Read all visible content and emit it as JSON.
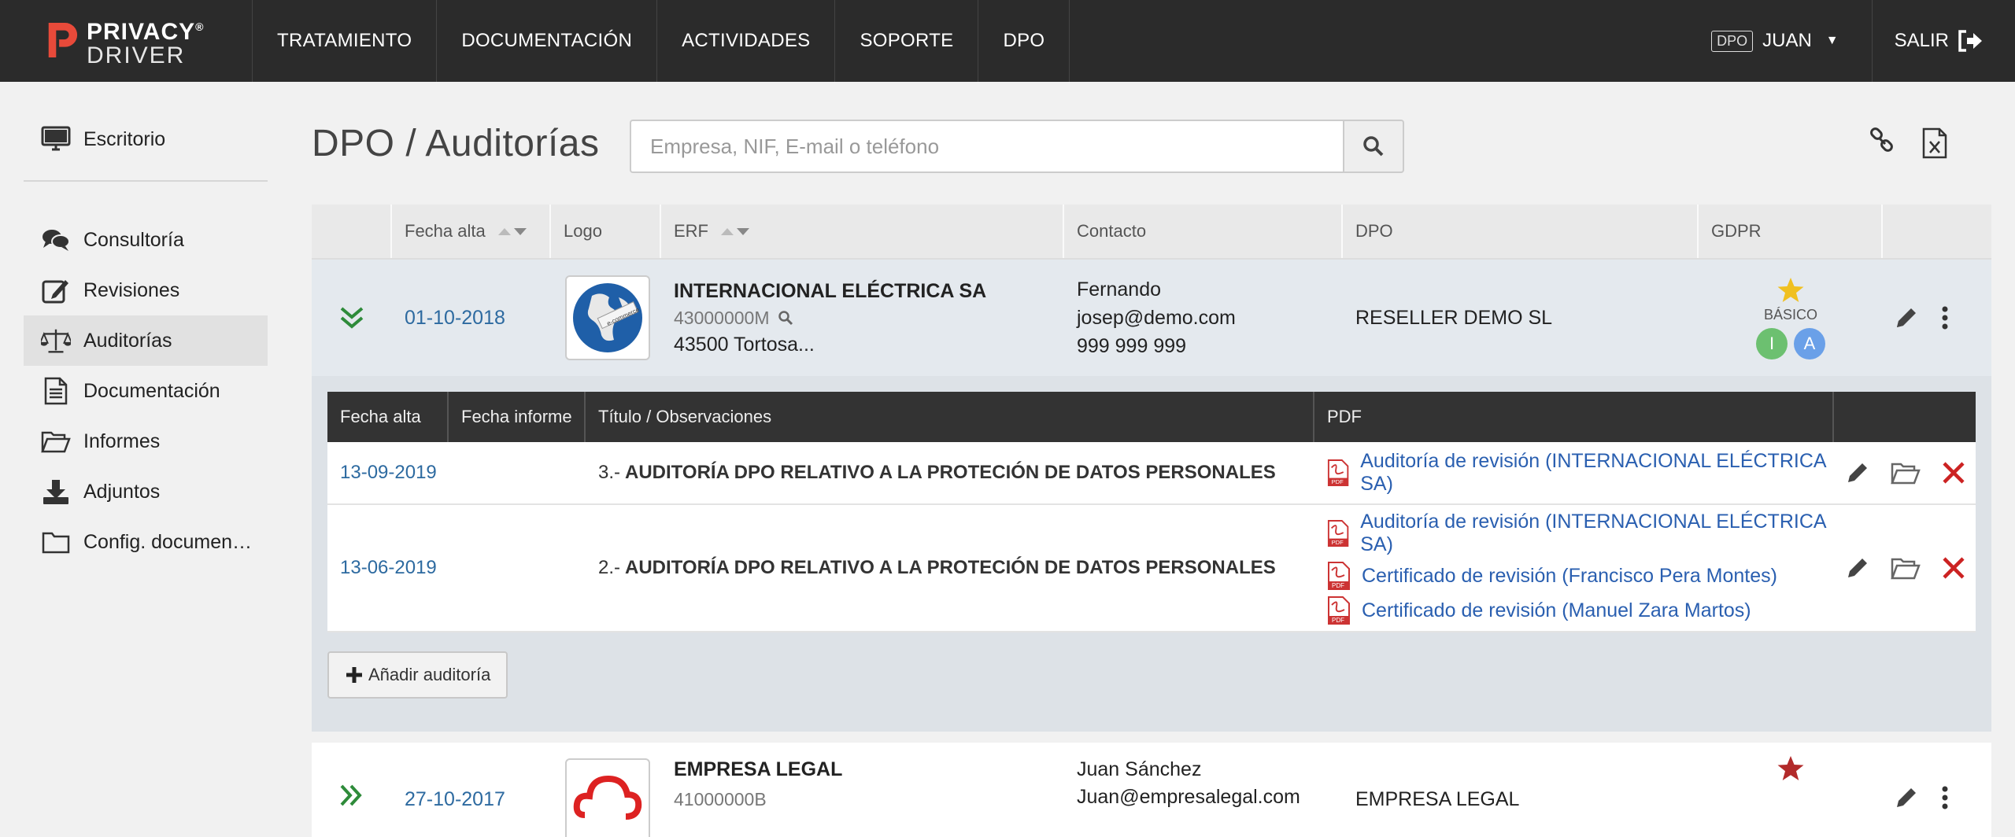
{
  "brand": {
    "line1": "PRIVACY",
    "line2": "DRIVER",
    "reg": "®"
  },
  "nav": [
    "TRATAMIENTO",
    "DOCUMENTACIÓN",
    "ACTIVIDADES",
    "SOPORTE",
    "DPO"
  ],
  "user": {
    "role_badge": "DPO",
    "name": "JUAN"
  },
  "logout_label": "SALIR",
  "sidebar": {
    "top_item": "Escritorio",
    "items": [
      "Consultoría",
      "Revisiones",
      "Auditorías",
      "Documentación",
      "Informes",
      "Adjuntos",
      "Config. documen…"
    ],
    "active": "Auditorías"
  },
  "page_title": "DPO / Auditorías",
  "search": {
    "placeholder": "Empresa, NIF, E-mail o teléfono",
    "value": ""
  },
  "table": {
    "headers": [
      "",
      "Fecha alta",
      "Logo",
      "ERF",
      "Contacto",
      "DPO",
      "GDPR",
      ""
    ],
    "rows": [
      {
        "fecha_alta": "01-10-2018",
        "erf_name": "INTERNACIONAL ELÉCTRICA SA",
        "nif": "43000000M",
        "address": "43500 Tortosa...",
        "contact_name": "Fernando",
        "contact_email": "josep@demo.com",
        "contact_phone": "999 999 999",
        "dpo": "RESELLER DEMO SL",
        "gdpr_level": "BÁSICO",
        "gdpr_badges": [
          "I",
          "A"
        ],
        "star_color": "#f0c020"
      },
      {
        "fecha_alta": "27-10-2017",
        "erf_name": "EMPRESA LEGAL",
        "nif": "41000000B",
        "contact_name": "Juan Sánchez",
        "contact_email": "Juan@empresalegal.com",
        "dpo": "EMPRESA LEGAL",
        "star_color": "#b22a2a"
      }
    ]
  },
  "audits": {
    "headers": [
      "Fecha alta",
      "Fecha informe",
      "Título / Observaciones",
      "PDF",
      ""
    ],
    "rows": [
      {
        "fecha_alta": "13-09-2019",
        "fecha_informe": "",
        "num": "3.-",
        "title": "AUDITORÍA DPO RELATIVO A LA PROTECIÓN DE DATOS PERSONALES",
        "pdfs": [
          "Auditoría de revisión (INTERNACIONAL ELÉCTRICA SA)"
        ]
      },
      {
        "fecha_alta": "13-06-2019",
        "fecha_informe": "",
        "num": "2.-",
        "title": "AUDITORÍA DPO RELATIVO A LA PROTECIÓN DE DATOS PERSONALES",
        "pdfs": [
          "Auditoría de revisión (INTERNACIONAL ELÉCTRICA SA)",
          "Certificado de revisión (Francisco Pera Montes)",
          "Certificado de revisión (Manuel Zara Martos)"
        ]
      }
    ],
    "add_button": "Añadir auditoría"
  },
  "colors": {
    "topbar": "#2b2b2b",
    "link": "#2a5fb0",
    "date": "#2d6aa0",
    "badge_i": "#6cc070",
    "badge_a": "#6aa0e8",
    "delete": "#cc2222"
  }
}
